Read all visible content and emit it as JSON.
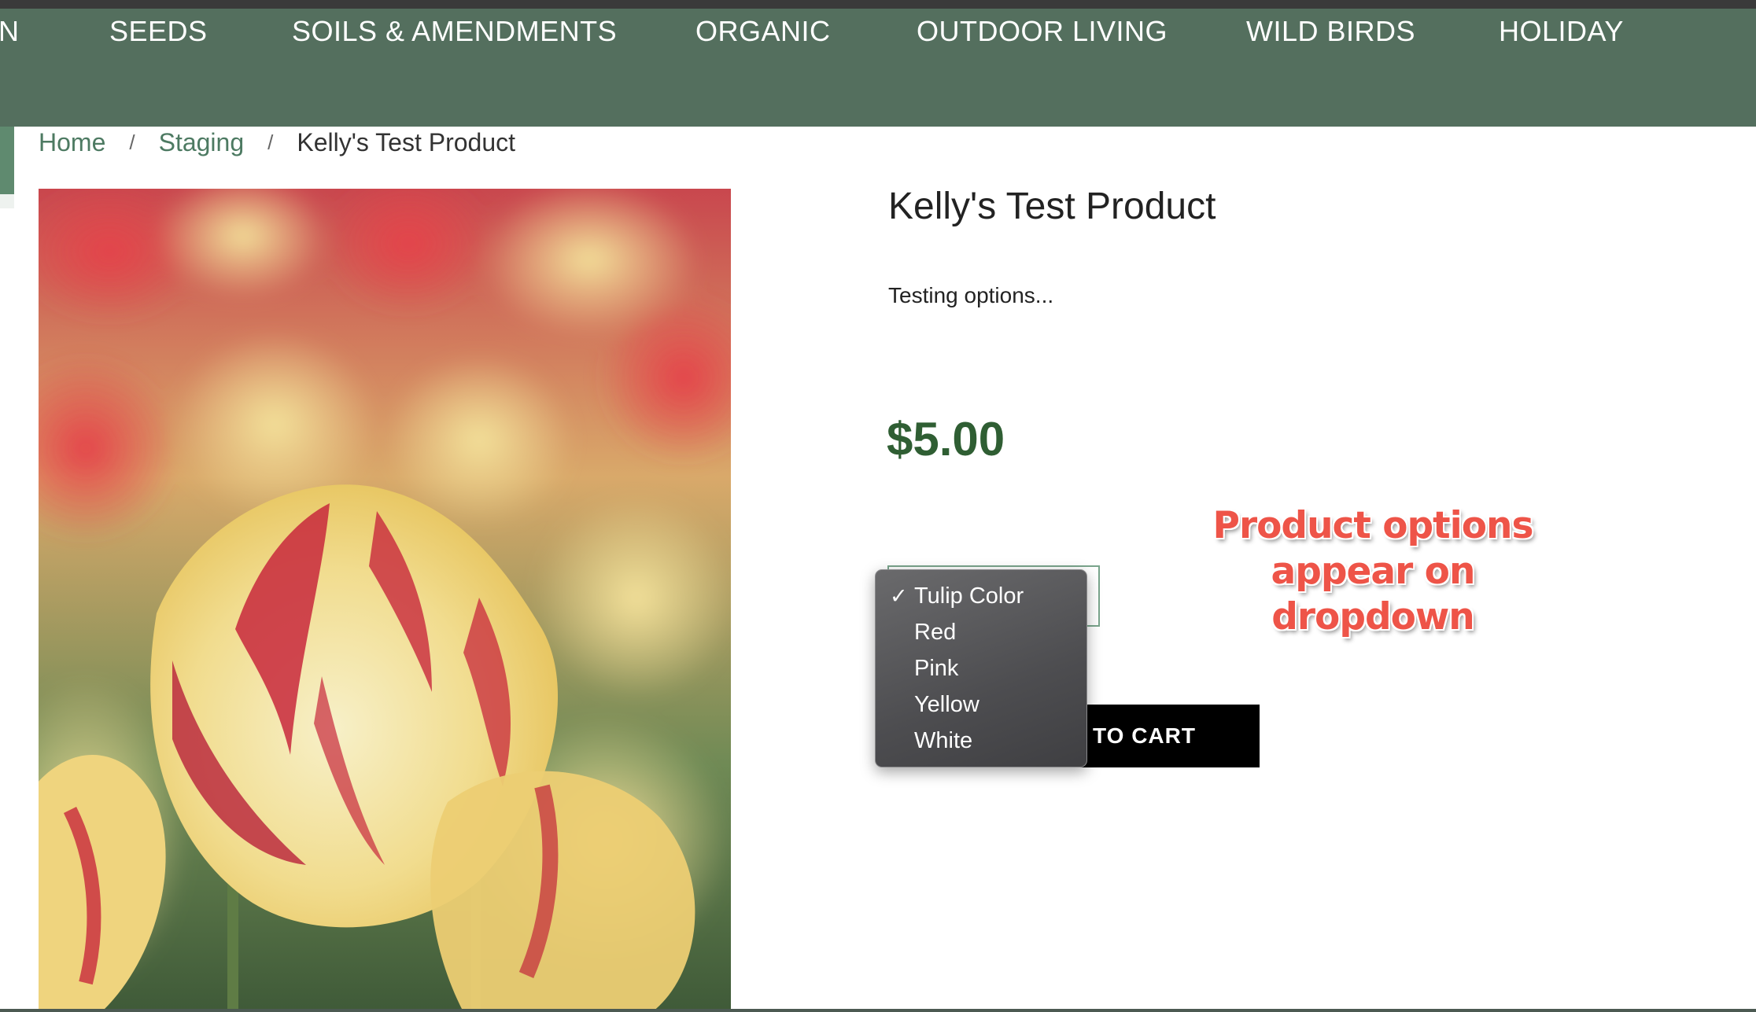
{
  "nav": {
    "items": [
      {
        "label": "N"
      },
      {
        "label": "SEEDS"
      },
      {
        "label": "SOILS & AMENDMENTS"
      },
      {
        "label": "ORGANIC"
      },
      {
        "label": "OUTDOOR LIVING"
      },
      {
        "label": "WILD BIRDS"
      },
      {
        "label": "HOLIDAY"
      }
    ]
  },
  "breadcrumb": {
    "home": "Home",
    "sep1": "/",
    "staging": "Staging",
    "sep2": "/",
    "current": "Kelly's Test Product"
  },
  "product": {
    "title": "Kelly's Test Product",
    "description": "Testing options...",
    "price": "$5.00",
    "add_to_cart_label": "D TO CART",
    "image_icon": "tulip-photo"
  },
  "dropdown": {
    "check_icon": "✓",
    "options": [
      {
        "label": "Tulip Color",
        "selected": true
      },
      {
        "label": "Red",
        "selected": false
      },
      {
        "label": "Pink",
        "selected": false
      },
      {
        "label": "Yellow",
        "selected": false
      },
      {
        "label": "White",
        "selected": false
      }
    ]
  },
  "annotation": {
    "line1": "Product options",
    "line2": "appear on dropdown"
  },
  "colors": {
    "nav_bg": "#546f5e",
    "link": "#4d7a62",
    "price": "#2f5e33",
    "annotation": "#ee5448"
  }
}
